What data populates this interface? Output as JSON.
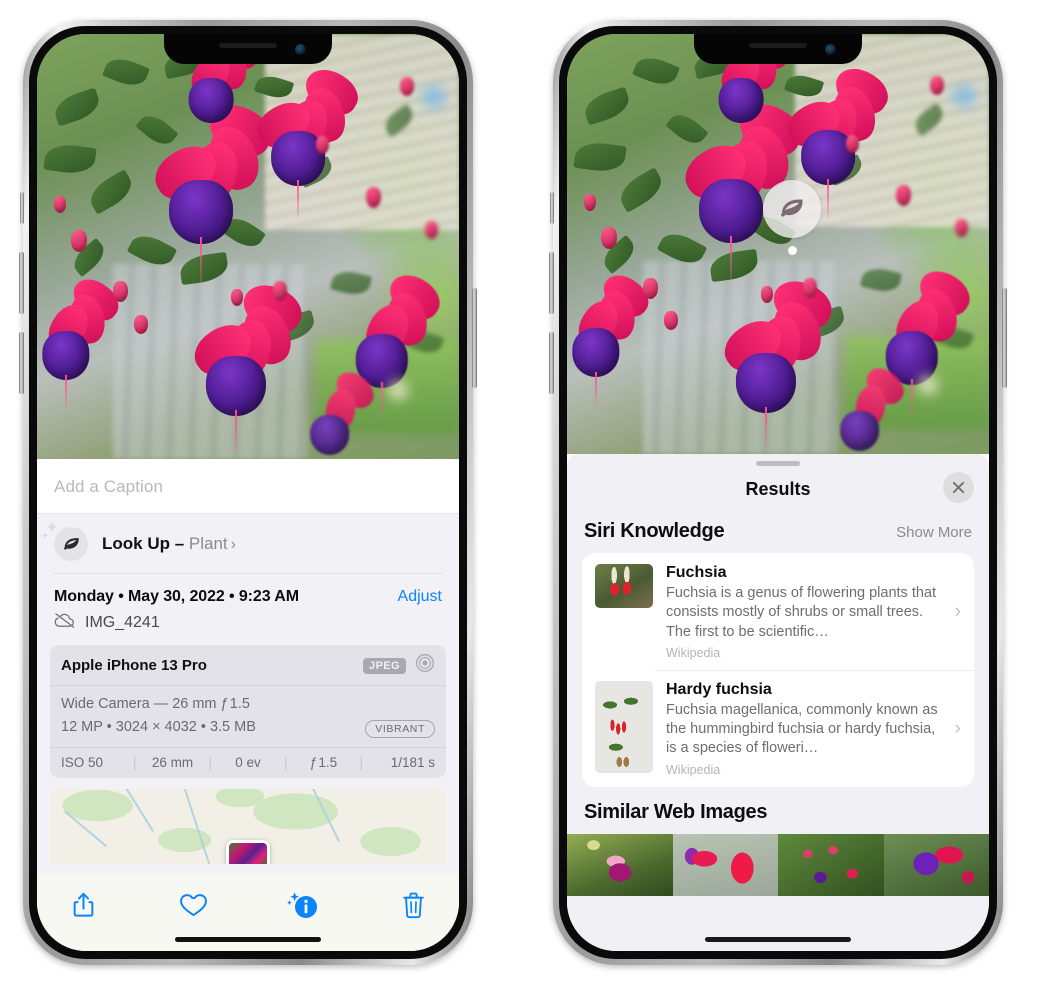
{
  "left_phone": {
    "caption": {
      "placeholder": "Add a Caption",
      "value": ""
    },
    "lookup": {
      "label": "Look Up – ",
      "subject": "Plant",
      "chevron": "›",
      "icon": "leaf-icon"
    },
    "date_line": "Monday • May 30, 2022 • 9:23 AM",
    "adjust_label": "Adjust",
    "filename": "IMG_4241",
    "cloud_icon": "icloud-slash-icon",
    "camera_card": {
      "model": "Apple iPhone 13 Pro",
      "format_badge": "JPEG",
      "lens_icon": "aperture-icon",
      "lens_line": "Wide Camera — 26 mm ƒ 1.5",
      "spec_line": "12 MP • 3024 × 4032 • 3.5 MB",
      "style_badge": "VIBRANT",
      "exif": [
        "ISO 50",
        "26 mm",
        "0 ev",
        "ƒ 1.5",
        "1/181 s"
      ]
    },
    "toolbar": [
      {
        "name": "share-icon",
        "label": "Share"
      },
      {
        "name": "heart-icon",
        "label": "Favorite"
      },
      {
        "name": "info-sparkle-icon",
        "label": "Info"
      },
      {
        "name": "trash-icon",
        "label": "Delete"
      }
    ]
  },
  "right_phone": {
    "leaf_badge_icon": "leaf-icon",
    "sheet": {
      "title": "Results",
      "close_icon": "close-icon",
      "sections": [
        {
          "title": "Siri Knowledge",
          "action": "Show More",
          "items": [
            {
              "title": "Fuchsia",
              "description": "Fuchsia is a genus of flowering plants that consists mostly of shrubs or small trees. The first to be scientific…",
              "source": "Wikipedia",
              "chevron": "›"
            },
            {
              "title": "Hardy fuchsia",
              "description": "Fuchsia magellanica, commonly known as the hummingbird fuchsia or hardy fuchsia, is a species of floweri…",
              "source": "Wikipedia",
              "chevron": "›"
            }
          ]
        },
        {
          "title": "Similar Web Images",
          "action": "",
          "images": [
            "web-image-1",
            "web-image-2",
            "web-image-3",
            "web-image-4"
          ]
        }
      ]
    }
  },
  "colors": {
    "accent_blue": "#0a84ff",
    "sheet_bg": "#f1f0f5",
    "card_bg": "#ffffff",
    "secondary_text": "#6d6d73",
    "tertiary_text": "#b4b4b9"
  }
}
